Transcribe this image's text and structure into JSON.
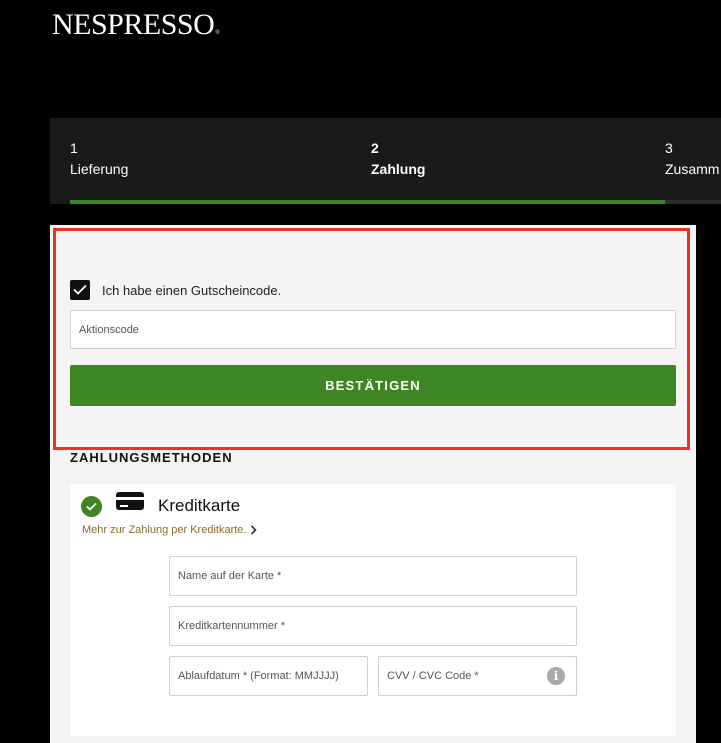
{
  "brand": {
    "logo_text": "NESPRESSO",
    "logo_mark": "®"
  },
  "steps": [
    {
      "num": "1",
      "label": "Lieferung",
      "active": false
    },
    {
      "num": "2",
      "label": "Zahlung",
      "active": true
    },
    {
      "num": "3",
      "label": "Zusamm",
      "active": false
    }
  ],
  "voucher": {
    "checkbox_label": "Ich habe einen Gutscheincode.",
    "checked": true,
    "promo_placeholder": "Aktionscode",
    "confirm_label": "BESTÄTIGEN"
  },
  "payment": {
    "section_title": "ZAHLUNGSMETHODEN",
    "method_title": "Kreditkarte",
    "method_link": "Mehr zur Zahlung per Kreditkarte.",
    "fields": {
      "name_placeholder": "Name auf der Karte *",
      "number_placeholder": "Kreditkartennummer *",
      "expiry_placeholder": "Ablaufdatum * (Format: MMJJJJ)",
      "cvv_placeholder": "CVV / CVC Code *"
    },
    "info_glyph": "i"
  },
  "colors": {
    "accent": "#3d8623",
    "highlight": "#ea3323",
    "link": "#8a6a2e"
  },
  "icons": [
    "check-icon",
    "credit-card-icon",
    "chevron-right-icon",
    "info-icon"
  ]
}
